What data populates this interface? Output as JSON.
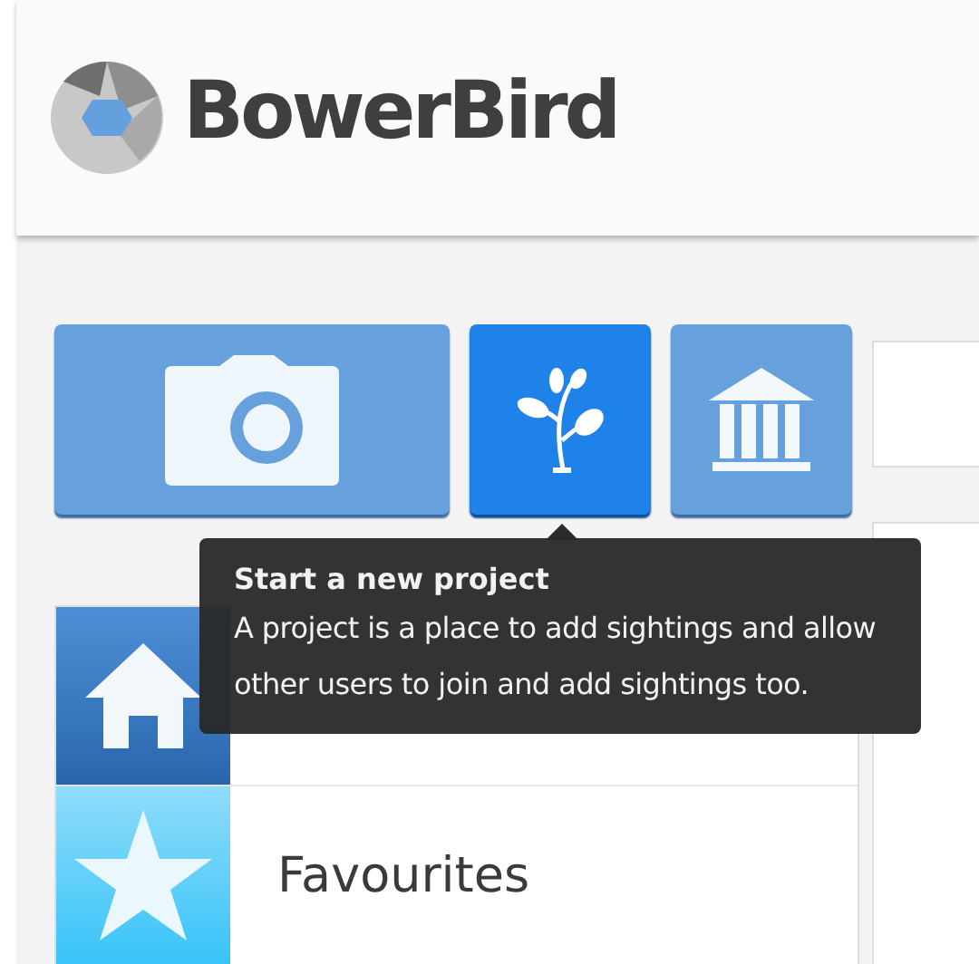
{
  "header": {
    "brand": "BowerBird"
  },
  "action_buttons": [
    {
      "kind": "camera",
      "selected": false
    },
    {
      "kind": "plant",
      "selected": true
    },
    {
      "kind": "museum",
      "selected": false
    }
  ],
  "tooltip": {
    "title": "Start a new project",
    "body": "A project is a place to add sightings and allow other users to join and add sightings too."
  },
  "menu": [
    {
      "kind": "home"
    },
    {
      "kind": "star",
      "label": "Favourites"
    }
  ]
}
